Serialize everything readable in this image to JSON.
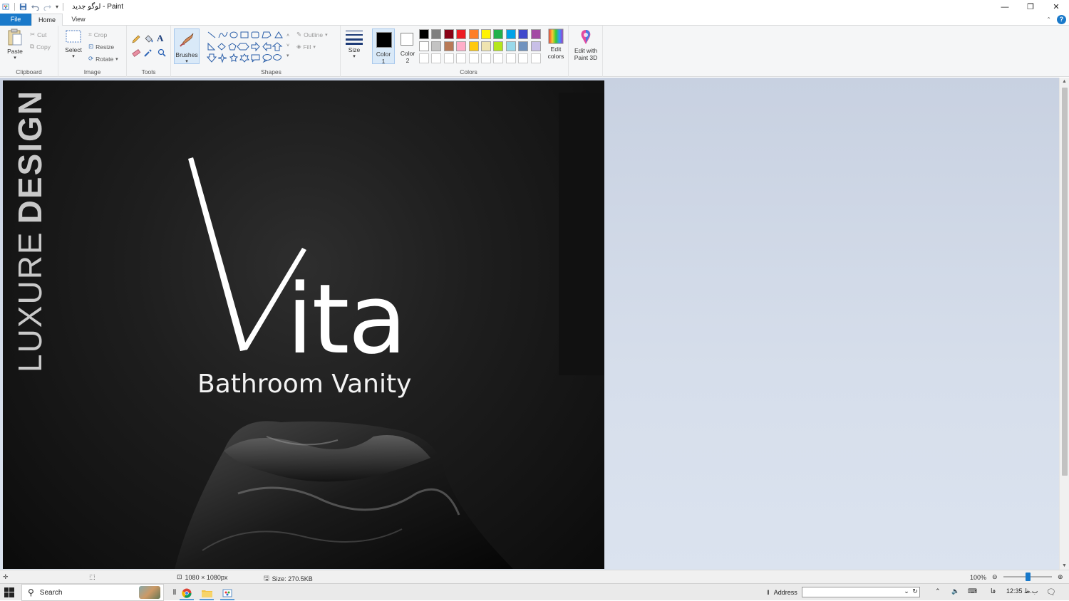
{
  "window": {
    "title": "لوگو جدید - Paint",
    "controls": [
      "minimize",
      "restore",
      "close"
    ]
  },
  "tabs": {
    "file": "File",
    "home": "Home",
    "view": "View"
  },
  "ribbon": {
    "clipboard": {
      "label": "Clipboard",
      "paste": "Paste",
      "cut": "Cut",
      "copy": "Copy"
    },
    "image": {
      "label": "Image",
      "select": "Select",
      "crop": "Crop",
      "resize": "Resize",
      "rotate": "Rotate"
    },
    "tools": {
      "label": "Tools",
      "brushes": "Brushes"
    },
    "shapes": {
      "label": "Shapes",
      "outline": "Outline",
      "fill": "Fill",
      "size": "Size"
    },
    "colors": {
      "label": "Colors",
      "color1_line1": "Color",
      "color1_line2": "1",
      "color2_line1": "Color",
      "color2_line2": "2",
      "edit_colors_line1": "Edit",
      "edit_colors_line2": "colors",
      "paint3d_line1": "Edit with",
      "paint3d_line2": "Paint 3D",
      "color1_value": "#000000",
      "color2_value": "#ffffff",
      "palette_row1": [
        "#000000",
        "#7f7f7f",
        "#880015",
        "#ed1c24",
        "#ff7f27",
        "#fff200",
        "#22b14c",
        "#00a2e8",
        "#3f48cc",
        "#a349a4"
      ],
      "palette_row2": [
        "#ffffff",
        "#c3c3c3",
        "#b97a57",
        "#ffaec9",
        "#ffc90e",
        "#efe4b0",
        "#b5e61d",
        "#99d9ea",
        "#7092be",
        "#c8bfe7"
      ],
      "palette_row3": [
        "#ffffff",
        "#ffffff",
        "#ffffff",
        "#ffffff",
        "#ffffff",
        "#ffffff",
        "#ffffff",
        "#ffffff",
        "#ffffff",
        "#ffffff"
      ]
    }
  },
  "canvas": {
    "vertical_text_light": "LUXURE",
    "vertical_text_bold": "DESIGN",
    "logo_letters": "ita",
    "logo_first": "V",
    "subtitle": "Bathroom Vanity"
  },
  "status": {
    "dimensions": "1080 × 1080px",
    "size": "Size: 270.5KB",
    "zoom": "100%"
  },
  "taskbar": {
    "search": "Search",
    "address_label": "Address",
    "lang": "فا",
    "clock": "12:35 ب.ظ"
  }
}
